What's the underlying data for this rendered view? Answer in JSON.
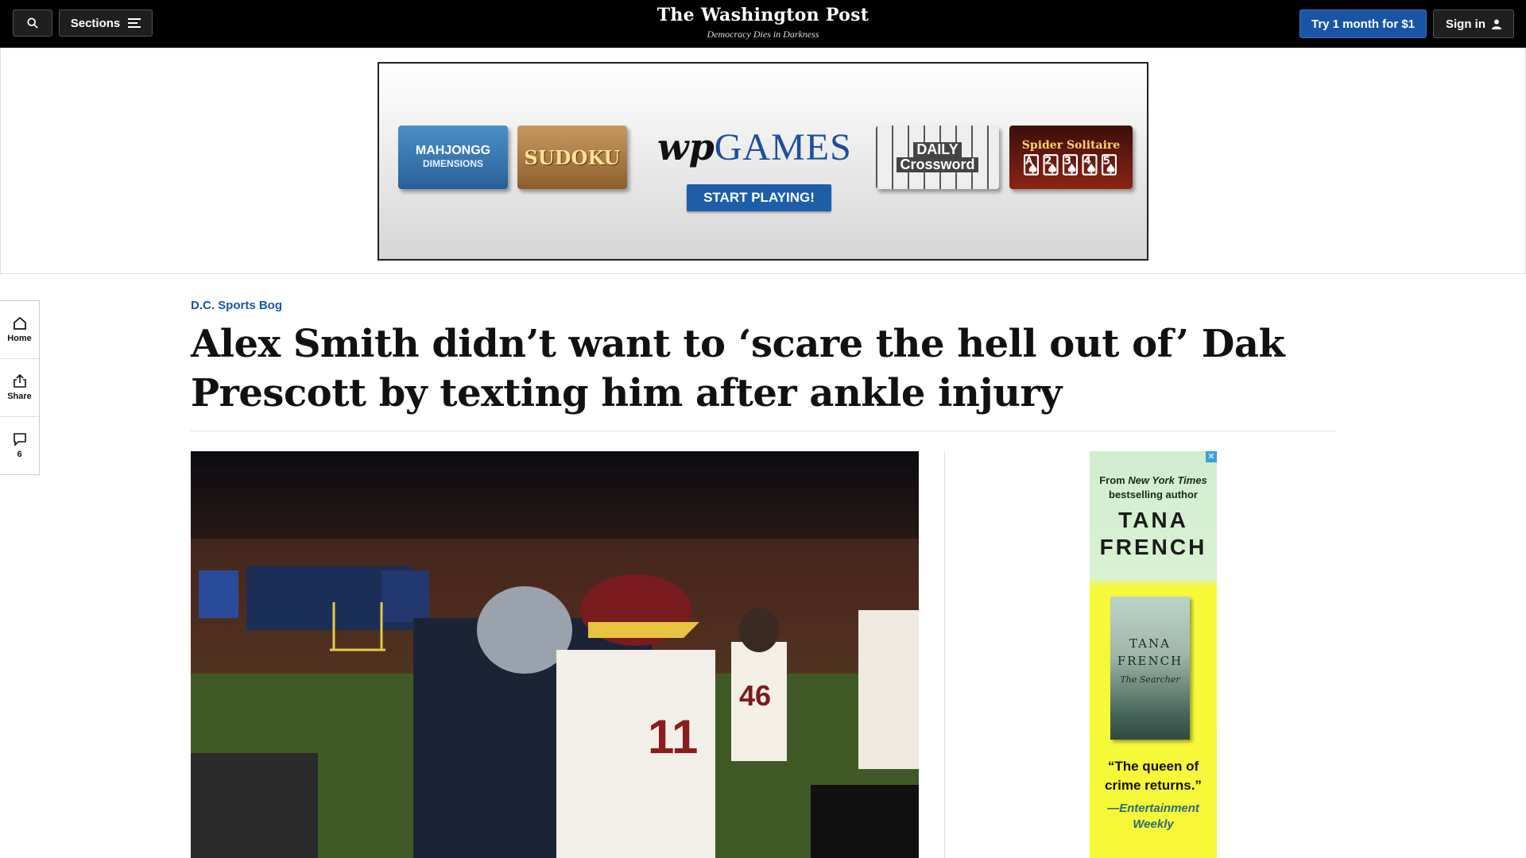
{
  "header": {
    "sections_label": "Sections",
    "logo_name": "The Washington Post",
    "tagline": "Democracy Dies in Darkness",
    "subscribe_label": "Try 1 month for $1",
    "signin_label": "Sign in"
  },
  "top_ad": {
    "tile_mahjong": "MAHJONGG",
    "tile_mahjong_sub": "DIMENSIONS",
    "tile_sudoku": "SUDOKU",
    "brand_mark": "wp",
    "brand_games": "GAMES",
    "cta": "START PLAYING!",
    "tile_crossword_1": "DAILY",
    "tile_crossword_2": "Crossword",
    "tile_spider": "Spider Solitaire"
  },
  "rail": {
    "home": "Home",
    "share": "Share",
    "comments_count": "6"
  },
  "article": {
    "kicker": "D.C. Sports Bog",
    "headline": "Alex Smith didn’t want to ‘scare the hell out of’ Dak Prescott by texting him after ankle injury"
  },
  "side_ad": {
    "line1": "From",
    "line1_em": "New York Times",
    "line2": "bestselling author",
    "author_1": "TANA",
    "author_2": "FRENCH",
    "book_author_1": "TANA",
    "book_author_2": "FRENCH",
    "book_title": "The Searcher",
    "quote": "“The queen of crime returns.”",
    "quote_source": "—Entertainment Weekly"
  },
  "colors": {
    "topbar": "#000000",
    "accent_blue": "#1955a5",
    "kicker_blue": "#1955a5"
  }
}
